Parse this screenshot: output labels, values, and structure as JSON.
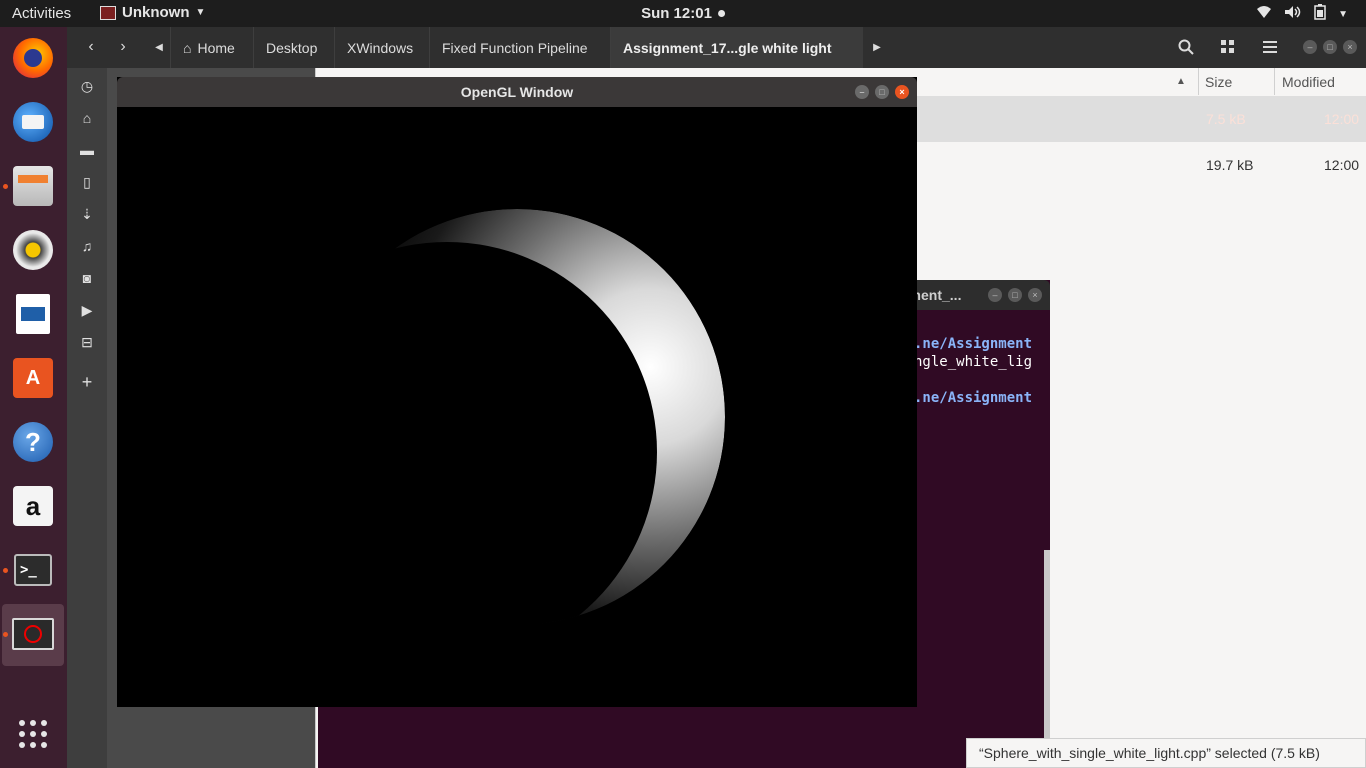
{
  "topbar": {
    "activities": "Activities",
    "app_name": "Unknown",
    "clock": "Sun 12:01"
  },
  "dock": {
    "items": [
      "firefox-icon",
      "thunderbird-icon",
      "files-icon",
      "rhythmbox-icon",
      "libreoffice-writer-icon",
      "ubuntu-software-icon",
      "help-icon",
      "amazon-icon",
      "terminal-icon",
      "opengl-app-icon"
    ]
  },
  "nautilus": {
    "breadcrumbs": [
      "Home",
      "Desktop",
      "XWindows",
      "Fixed Function Pipeline",
      "Assignment_17...gle white light"
    ],
    "columns": {
      "size": "Size",
      "modified": "Modified"
    },
    "rows": [
      {
        "size": "7.5 kB",
        "modified": "12:00"
      },
      {
        "size": "19.7 kB",
        "modified": "12:00"
      }
    ],
    "status": "“Sphere_with_single_white_light.cpp” selected  (7.5 kB)"
  },
  "terminal": {
    "title": "nment_...",
    "lines": [
      {
        "text": ".ne/Assignment",
        "style": "blue"
      },
      {
        "text": "ngle_white_lig",
        "style": "plain"
      },
      {
        "text": ".ne/Assignment",
        "style": "blue"
      }
    ]
  },
  "gl_window": {
    "title": "OpenGL Window"
  },
  "colors": {
    "accent": "#e95420",
    "dock_bg": "#3c1f2f",
    "terminal_bg": "#300a24",
    "terminal_prompt": "#8ab4f8"
  }
}
